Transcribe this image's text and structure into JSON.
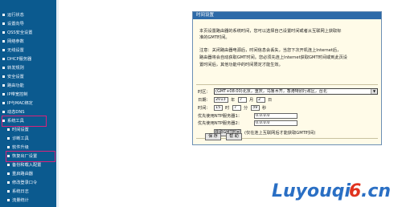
{
  "sidebar": {
    "items": [
      {
        "label": "运行状态"
      },
      {
        "label": "设置向导"
      },
      {
        "label": "QSS安全设置"
      },
      {
        "label": "网络参数"
      },
      {
        "label": "无线设置"
      },
      {
        "label": "DHCP服务器"
      },
      {
        "label": "转发规则"
      },
      {
        "label": "安全设置"
      },
      {
        "label": "路由功能"
      },
      {
        "label": "IP带宽控制"
      },
      {
        "label": "IP与MAC绑定"
      },
      {
        "label": "动态DNS"
      },
      {
        "label": "系统工具"
      }
    ],
    "subitems": [
      {
        "label": "时间设置"
      },
      {
        "label": "诊断工具"
      },
      {
        "label": "软件升级"
      },
      {
        "label": "恢复出厂设置"
      },
      {
        "label": "备份和载入配置"
      },
      {
        "label": "重启路由器"
      },
      {
        "label": "修改登录口令"
      },
      {
        "label": "系统日志"
      },
      {
        "label": "流量统计"
      }
    ]
  },
  "panel": {
    "title": "时间设置",
    "intro_line1": "本页设置路由器的系统时间，您可以选择自己设置时间或者从互联网上获取标",
    "intro_line2": "准的GMT时间。",
    "note_line1": "注意：关闭路由器电源后，时间信息会丢失，当您下次开机连上Internet后，",
    "note_line2": "路由器将会自动获取GMT时间。您必须先连上Internet获取GMT时间或到此页设",
    "note_line3": "置时间后，其他功能中的时间限定才能生效。",
    "timezone_label": "时区：",
    "timezone_value": "(GMT+08:00)北京，重庆，乌鲁木齐，香港特别行政区，台北",
    "date_label": "日期：",
    "year": "2013",
    "year_unit": "年",
    "month": "7",
    "month_unit": "月",
    "day": "2",
    "day_unit": "日",
    "time_label": "时间：",
    "hour": "15",
    "hour_unit": "时",
    "minute": "7",
    "minute_unit": "分",
    "second": "39",
    "second_unit": "秒",
    "ntp1_label": "优先使用NTP服务器1：",
    "ntp1_value": "0.0.0.0",
    "ntp2_label": "优先使用NTP服务器2：",
    "ntp2_value": "0.0.0.0",
    "get_gmt_button": "获取GMT时间",
    "get_gmt_hint": "(仅在连上互联网后才能获取GMT时间)",
    "save_button": "保 存",
    "help_button": "帮 助"
  },
  "watermark": {
    "text1": "Luyouqi",
    "text2": "6",
    "text3": ".cn",
    "colors": {
      "text1": "#2a6fc4",
      "text2": "#e0331f",
      "text3": "#2a6fc4"
    }
  },
  "colors": {
    "sidebar_bg": "#0b5a8f",
    "panel_title_bg": "#2d6aa8",
    "panel_bg": "#fffbe8",
    "highlight": "#d8227a"
  }
}
